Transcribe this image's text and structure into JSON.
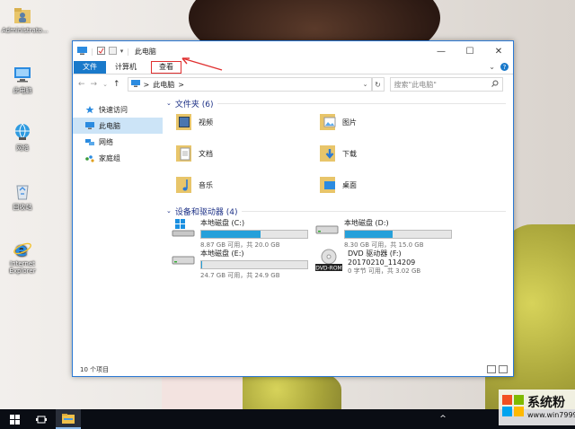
{
  "desktop": {
    "icons": [
      {
        "label": "Administrato...",
        "icon": "user-folder-icon"
      },
      {
        "label": "此电脑",
        "icon": "computer-icon"
      },
      {
        "label": "网络",
        "icon": "network-icon"
      },
      {
        "label": "回收站",
        "icon": "recycle-bin-icon"
      },
      {
        "label": "Internet Explorer",
        "icon": "internet-explorer-icon"
      }
    ]
  },
  "window": {
    "title": "此电脑",
    "controls": {
      "minimize": "—",
      "maximize": "☐",
      "close": "✕"
    },
    "ribbon": {
      "tabs": [
        {
          "label": "文件"
        },
        {
          "label": "计算机"
        },
        {
          "label": "查看"
        }
      ]
    },
    "address": {
      "path": "此电脑",
      "separator": ">",
      "search_placeholder": "搜索\"此电脑\""
    },
    "nav_pane": [
      {
        "label": "快速访问",
        "icon": "star-icon"
      },
      {
        "label": "此电脑",
        "icon": "computer-icon",
        "selected": true
      },
      {
        "label": "网络",
        "icon": "network-icon"
      },
      {
        "label": "家庭组",
        "icon": "homegroup-icon"
      }
    ],
    "folders_header": "文件夹 (6)",
    "folders": [
      {
        "label": "视频",
        "icon": "videos-folder-icon"
      },
      {
        "label": "图片",
        "icon": "pictures-folder-icon"
      },
      {
        "label": "文档",
        "icon": "documents-folder-icon"
      },
      {
        "label": "下载",
        "icon": "downloads-folder-icon"
      },
      {
        "label": "音乐",
        "icon": "music-folder-icon"
      },
      {
        "label": "桌面",
        "icon": "desktop-folder-icon"
      }
    ],
    "drives_header": "设备和驱动器 (4)",
    "drives": [
      {
        "name": "本地磁盘 (C:)",
        "free": "8.87 GB 可用，共 20.0 GB",
        "used_fraction": 0.56,
        "icon": "windows-drive-icon"
      },
      {
        "name": "本地磁盘 (D:)",
        "free": "8.30 GB 可用，共 15.0 GB",
        "used_fraction": 0.45,
        "icon": "hard-drive-icon"
      },
      {
        "name": "本地磁盘 (E:)",
        "free": "24.7 GB 可用，共 24.9 GB",
        "used_fraction": 0.01,
        "icon": "hard-drive-icon"
      },
      {
        "name": "DVD 驱动器 (F:)",
        "sub": "20170210_114209",
        "free": "0 字节 可用，共 3.02 GB",
        "icon": "dvd-drive-icon",
        "icon_label": "DVD-ROM"
      }
    ],
    "status": "10 个项目"
  },
  "watermark": {
    "text": "系统粉",
    "url": "www.win7999.com"
  },
  "colors": {
    "accent": "#1979ca",
    "bar_fill": "#26a0da",
    "annotation": "#e03030"
  }
}
